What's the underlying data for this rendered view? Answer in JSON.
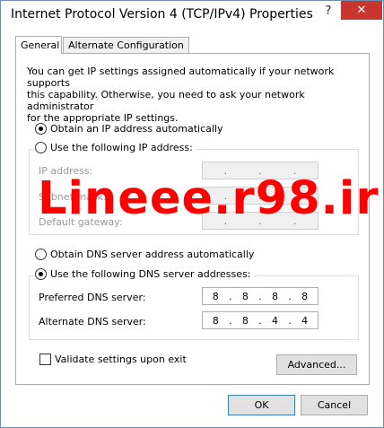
{
  "window": {
    "title": "Internet Protocol Version 4 (TCP/IPv4) Properties",
    "help": "?",
    "close": "✕"
  },
  "tabs": [
    {
      "label": "General"
    },
    {
      "label": "Alternate Configuration"
    }
  ],
  "description": "You can get IP settings assigned automatically if your network supports\nthis capability. Otherwise, you need to ask your network administrator\nfor the appropriate IP settings.",
  "ip_options": {
    "auto": {
      "label": "Obtain an IP address automatically",
      "checked": true
    },
    "manual": {
      "label": "Use the following IP address:",
      "checked": false
    }
  },
  "ip_fields": {
    "ip_address": {
      "label": "IP address:",
      "value": [
        ".",
        ".",
        "."
      ]
    },
    "subnet_mask": {
      "label": "Subnet mask:",
      "value": [
        ".",
        ".",
        "."
      ]
    },
    "default_gateway": {
      "label": "Default gateway:",
      "value": [
        ".",
        ".",
        "."
      ]
    }
  },
  "dns_options": {
    "auto": {
      "label": "Obtain DNS server address automatically",
      "checked": false
    },
    "manual": {
      "label": "Use the following DNS server addresses:",
      "checked": true
    }
  },
  "dns_fields": {
    "preferred": {
      "label": "Preferred DNS server:",
      "octets": [
        "8",
        ".",
        "8",
        ".",
        "8",
        ".",
        "8"
      ]
    },
    "alternate": {
      "label": "Alternate DNS server:",
      "octets": [
        "8",
        ".",
        "8",
        ".",
        "4",
        ".",
        "4"
      ]
    }
  },
  "validate": {
    "label": "Validate settings upon exit",
    "checked": false
  },
  "buttons": {
    "advanced": "Advanced...",
    "ok": "OK",
    "cancel": "Cancel"
  },
  "watermark": "Lineee.r98.ir",
  "colors": {
    "close_bg": "#c7372f",
    "watermark": "#ff0000",
    "window_border": "#6d8fb4"
  }
}
